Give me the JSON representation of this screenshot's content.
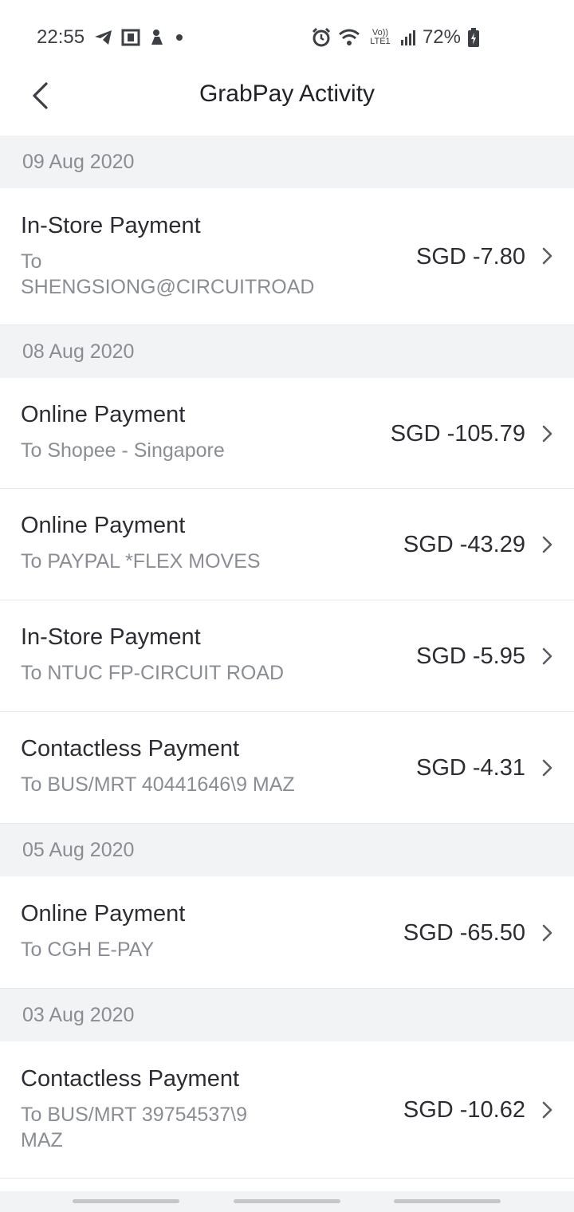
{
  "status_bar": {
    "time": "22:55",
    "network_label": "Vo)) LTE1",
    "battery": "72%"
  },
  "header": {
    "title": "GrabPay Activity"
  },
  "groups": [
    {
      "date": "09 Aug 2020",
      "items": [
        {
          "title": "In-Store Payment",
          "subtitle": "To SHENGSIONG@CIRCUITROAD",
          "amount": "SGD -7.80"
        }
      ]
    },
    {
      "date": "08 Aug 2020",
      "items": [
        {
          "title": "Online Payment",
          "subtitle": "To Shopee - Singapore",
          "amount": "SGD -105.79"
        },
        {
          "title": "Online Payment",
          "subtitle": "To PAYPAL *FLEX MOVES",
          "amount": "SGD -43.29"
        },
        {
          "title": "In-Store Payment",
          "subtitle": "To NTUC FP-CIRCUIT ROAD",
          "amount": "SGD -5.95"
        },
        {
          "title": "Contactless Payment",
          "subtitle": "To BUS/MRT 40441646\\9 MAZ",
          "amount": "SGD -4.31"
        }
      ]
    },
    {
      "date": "05 Aug 2020",
      "items": [
        {
          "title": "Online Payment",
          "subtitle": "To CGH E-PAY",
          "amount": "SGD -65.50"
        }
      ]
    },
    {
      "date": "03 Aug 2020",
      "items": [
        {
          "title": "Contactless Payment",
          "subtitle": "To BUS/MRT 39754537\\9 MAZ",
          "amount": "SGD -10.62"
        }
      ]
    }
  ],
  "icons": {
    "back": "chevron-left-icon",
    "row_chevron": "chevron-right-icon"
  },
  "colors": {
    "text_primary": "#2b2d32",
    "text_secondary": "#8a8d93",
    "section_bg": "#f2f3f5",
    "divider": "#e6e7ea"
  }
}
